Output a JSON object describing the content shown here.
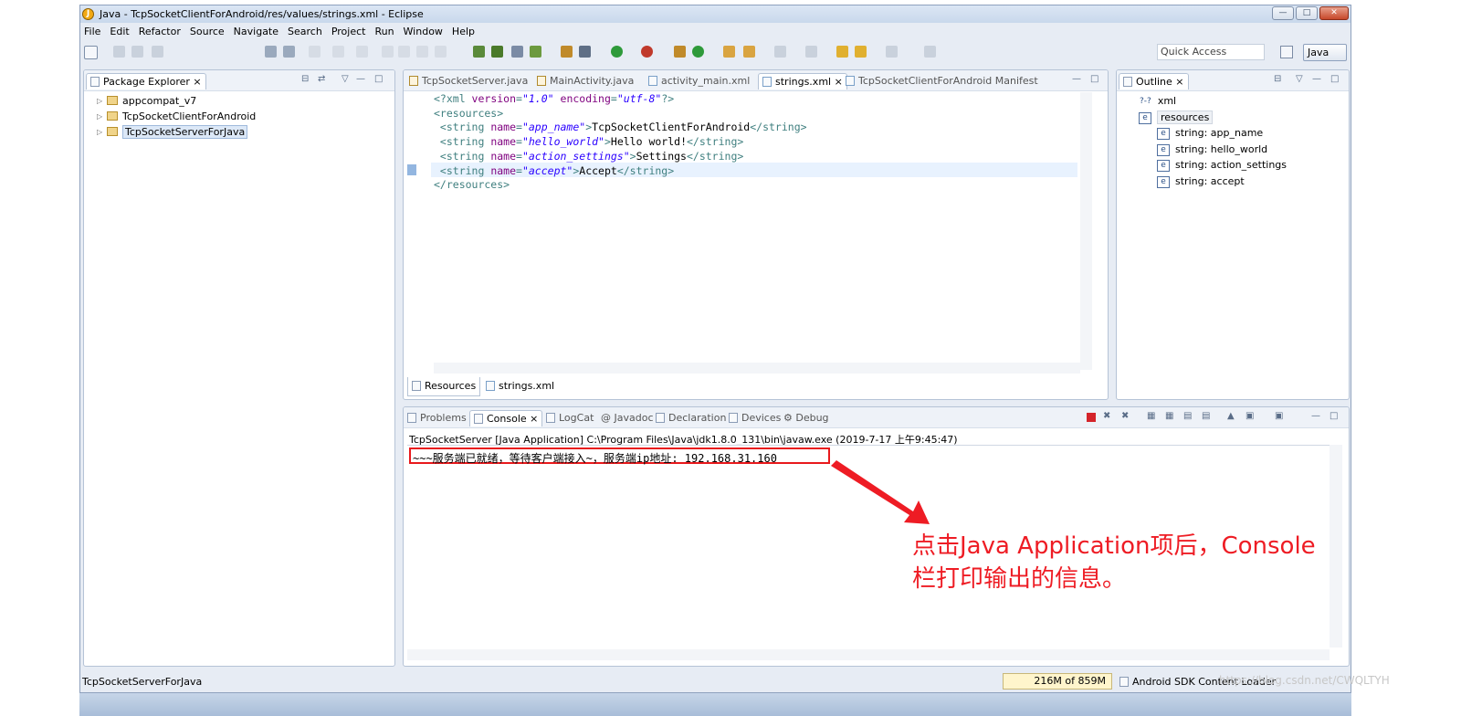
{
  "window": {
    "title": "Java - TcpSocketClientForAndroid/res/values/strings.xml - Eclipse",
    "logo_letter": "J"
  },
  "menu": [
    "File",
    "Edit",
    "Refactor",
    "Source",
    "Navigate",
    "Search",
    "Project",
    "Run",
    "Window",
    "Help"
  ],
  "toolbar": {
    "quick_access_placeholder": "Quick Access",
    "perspective": "Java"
  },
  "package_explorer": {
    "title": "Package Explorer",
    "projects": [
      {
        "name": "appcompat_v7",
        "selected": false
      },
      {
        "name": "TcpSocketClientForAndroid",
        "selected": false
      },
      {
        "name": "TcpSocketServerForJava",
        "selected": true
      }
    ]
  },
  "editor": {
    "tabs": [
      "TcpSocketServer.java",
      "MainActivity.java",
      "activity_main.xml",
      "strings.xml",
      "TcpSocketClientForAndroid Manifest"
    ],
    "active_tab": "strings.xml",
    "lines": [
      {
        "parts": [
          {
            "t": "tag",
            "v": "<?xml "
          },
          {
            "t": "attr",
            "v": "version"
          },
          {
            "t": "tag",
            "v": "="
          },
          {
            "t": "val",
            "v": "\"1.0\""
          },
          {
            "t": "tag",
            "v": " "
          },
          {
            "t": "attr",
            "v": "encoding"
          },
          {
            "t": "tag",
            "v": "="
          },
          {
            "t": "val",
            "v": "\"utf-8\""
          },
          {
            "t": "tag",
            "v": "?>"
          }
        ]
      },
      {
        "parts": [
          {
            "t": "tag",
            "v": "<resources>"
          }
        ]
      },
      {
        "parts": [
          {
            "t": "tag",
            "v": " <string "
          },
          {
            "t": "attr",
            "v": "name"
          },
          {
            "t": "tag",
            "v": "="
          },
          {
            "t": "val",
            "v": "\"app_name\""
          },
          {
            "t": "tag",
            "v": ">"
          },
          {
            "t": "text",
            "v": "TcpSocketClientForAndroid"
          },
          {
            "t": "tag",
            "v": "</string>"
          }
        ]
      },
      {
        "parts": [
          {
            "t": "tag",
            "v": " <string "
          },
          {
            "t": "attr",
            "v": "name"
          },
          {
            "t": "tag",
            "v": "="
          },
          {
            "t": "val",
            "v": "\"hello_world\""
          },
          {
            "t": "tag",
            "v": ">"
          },
          {
            "t": "text",
            "v": "Hello world!"
          },
          {
            "t": "tag",
            "v": "</string>"
          }
        ]
      },
      {
        "parts": [
          {
            "t": "tag",
            "v": " <string "
          },
          {
            "t": "attr",
            "v": "name"
          },
          {
            "t": "tag",
            "v": "="
          },
          {
            "t": "val",
            "v": "\"action_settings\""
          },
          {
            "t": "tag",
            "v": ">"
          },
          {
            "t": "text",
            "v": "Settings"
          },
          {
            "t": "tag",
            "v": "</string>"
          }
        ]
      },
      {
        "parts": [
          {
            "t": "tag",
            "v": " <string "
          },
          {
            "t": "attr",
            "v": "name"
          },
          {
            "t": "tag",
            "v": "="
          },
          {
            "t": "val",
            "v": "\"accept\""
          },
          {
            "t": "tag",
            "v": ">"
          },
          {
            "t": "text",
            "v": "Accept"
          },
          {
            "t": "tag",
            "v": "</string>"
          }
        ]
      },
      {
        "parts": [
          {
            "t": "tag",
            "v": "</resources>"
          }
        ]
      }
    ],
    "bottom_tabs": [
      "Resources",
      "strings.xml"
    ]
  },
  "outline": {
    "title": "Outline",
    "items": [
      {
        "label": "xml",
        "level": 0,
        "icon": "?-?"
      },
      {
        "label": "resources",
        "level": 0,
        "icon": "e"
      },
      {
        "label": "string: app_name",
        "level": 1,
        "icon": "e"
      },
      {
        "label": "string: hello_world",
        "level": 1,
        "icon": "e"
      },
      {
        "label": "string: action_settings",
        "level": 1,
        "icon": "e"
      },
      {
        "label": "string: accept",
        "level": 1,
        "icon": "e"
      }
    ]
  },
  "console": {
    "tabs": [
      "Problems",
      "Console",
      "LogCat",
      "Javadoc",
      "Declaration",
      "Devices",
      "Debug"
    ],
    "active_tab": "Console",
    "header": "TcpSocketServer [Java Application] C:\\Program Files\\Java\\jdk1.8.0_131\\bin\\javaw.exe (2019-7-17 上午9:45:47)",
    "output": "~~~服务端已就绪，等待客户端接入~，服务端ip地址: 192.168.31.160"
  },
  "annotation": {
    "line1": "点击Java Application项后，Console",
    "line2": "栏打印输出的信息。",
    "color": "#ee1c24"
  },
  "status": {
    "selection": "TcpSocketServerForJava",
    "heap": "216M of 859M",
    "loader": "Android SDK Content Loader"
  },
  "watermark": "https://blog.csdn.net/CWQLTYH"
}
